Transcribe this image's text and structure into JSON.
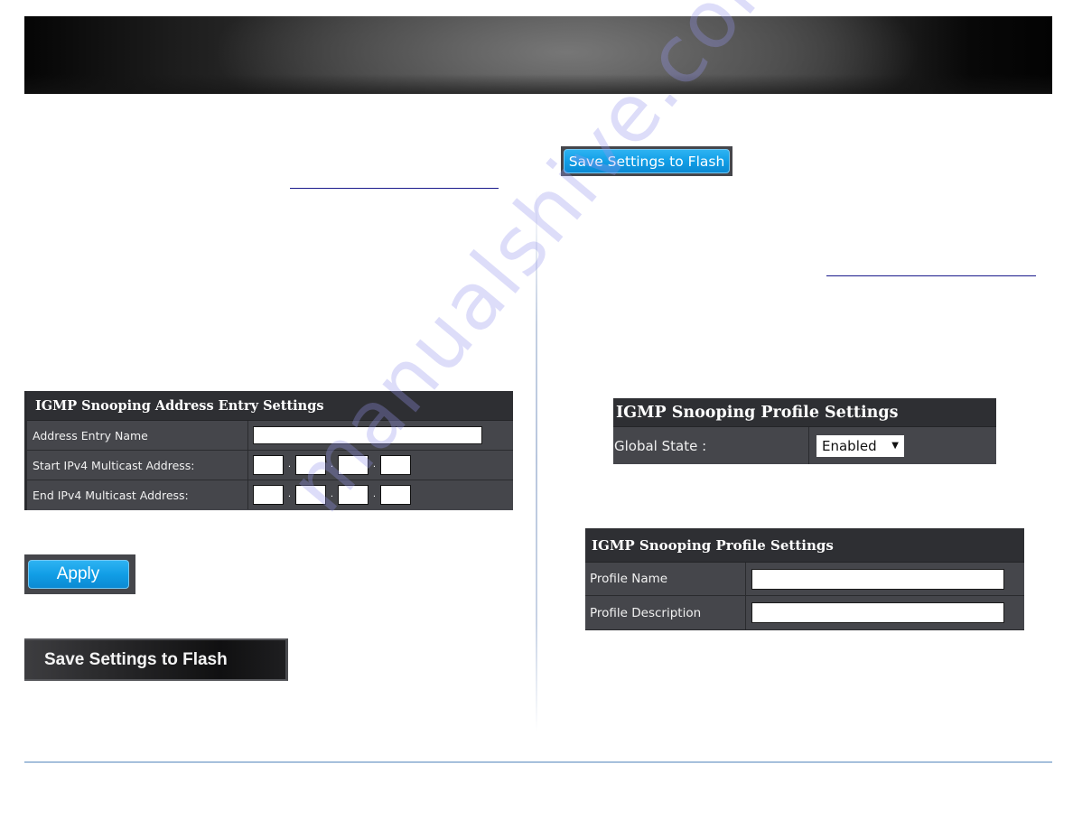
{
  "page": {
    "watermark": "manualshive.com"
  },
  "left_column": {
    "address_entry_panel": {
      "title": "IGMP Snooping Address Entry Settings",
      "rows": [
        {
          "label": "Address Entry Name",
          "type": "text",
          "value": ""
        },
        {
          "label": "Start IPv4 Multicast Address:",
          "type": "ipv4",
          "octets": [
            "",
            "",
            "",
            ""
          ],
          "separator": "."
        },
        {
          "label": "End IPv4 Multicast Address:",
          "type": "ipv4",
          "octets": [
            "",
            "",
            "",
            ""
          ],
          "separator": "."
        }
      ]
    },
    "apply_button": {
      "label": "Apply"
    },
    "save_settings_dark_button": {
      "label": "Save Settings to Flash"
    }
  },
  "right_column": {
    "save_settings_button": {
      "label": "Save Settings to Flash"
    },
    "global_panel": {
      "title": "IGMP Snooping Profile Settings",
      "rows": [
        {
          "label": "Global State :",
          "type": "select",
          "selected": "Enabled"
        }
      ]
    },
    "profile_panel": {
      "title": "IGMP Snooping Profile Settings",
      "rows": [
        {
          "label": "Profile Name",
          "type": "text",
          "value": ""
        },
        {
          "label": "Profile Description",
          "type": "text",
          "value": ""
        }
      ]
    }
  },
  "colors": {
    "panel_background": "#45464b",
    "panel_title_background": "#2e2f33",
    "button_blue": "#119ee6",
    "link_underline": "#1a1a8c",
    "footer_rule": "#a6c0dc"
  }
}
